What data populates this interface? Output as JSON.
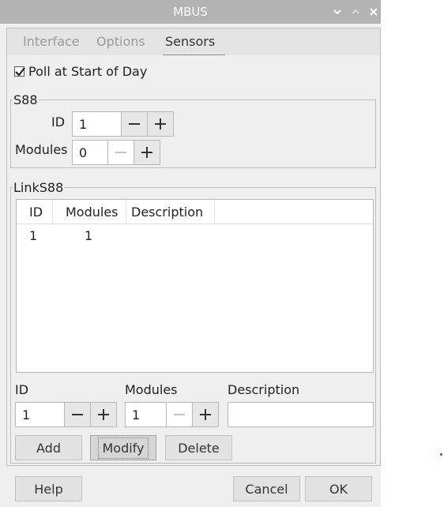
{
  "window": {
    "title": "MBUS"
  },
  "tabs": [
    {
      "label": "Interface",
      "active": false
    },
    {
      "label": "Options",
      "active": false
    },
    {
      "label": "Sensors",
      "active": true
    }
  ],
  "poll": {
    "label": "Poll at Start of Day",
    "checked": true
  },
  "s88": {
    "title": "S88",
    "id_label": "ID",
    "id_value": "1",
    "modules_label": "Modules",
    "modules_value": "0"
  },
  "links88": {
    "title": "LinkS88",
    "columns": [
      "ID",
      "Modules",
      "Description"
    ],
    "rows": [
      {
        "id": "1",
        "modules": "1",
        "description": ""
      }
    ],
    "id_label": "ID",
    "id_value": "1",
    "modules_label": "Modules",
    "modules_value": "1",
    "description_label": "Description",
    "description_value": "",
    "add_label": "Add",
    "modify_label": "Modify",
    "delete_label": "Delete"
  },
  "footer": {
    "help_label": "Help",
    "cancel_label": "Cancel",
    "ok_label": "OK"
  },
  "colors": {
    "titlebar": "#b3b3b3",
    "background": "#efefef",
    "accent_dot": "#dd2222"
  }
}
